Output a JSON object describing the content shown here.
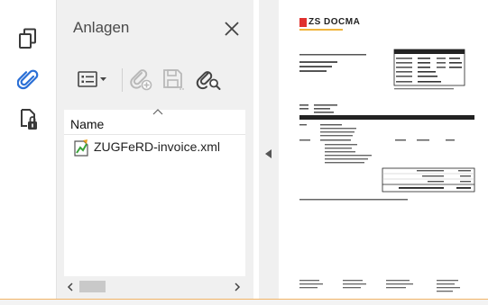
{
  "panel": {
    "title": "Anlagen",
    "column_header": "Name",
    "attachments": [
      {
        "name": "ZUGFeRD-invoice.xml"
      }
    ]
  },
  "document": {
    "logo_text": "ZS DOCMA"
  },
  "icons": {
    "rail": [
      "pages-icon",
      "paperclip-icon",
      "lock-doc-icon"
    ],
    "toolbar": [
      "options-menu-icon",
      "add-attachment-icon",
      "save-attachment-icon",
      "search-attachment-icon"
    ]
  },
  "colors": {
    "accent_blue": "#2a6fd6",
    "panel_bg": "#f0f0f0",
    "bottom_accent": "#f2b466",
    "logo_red": "#e0302e",
    "logo_yellow": "#f0b43c"
  }
}
